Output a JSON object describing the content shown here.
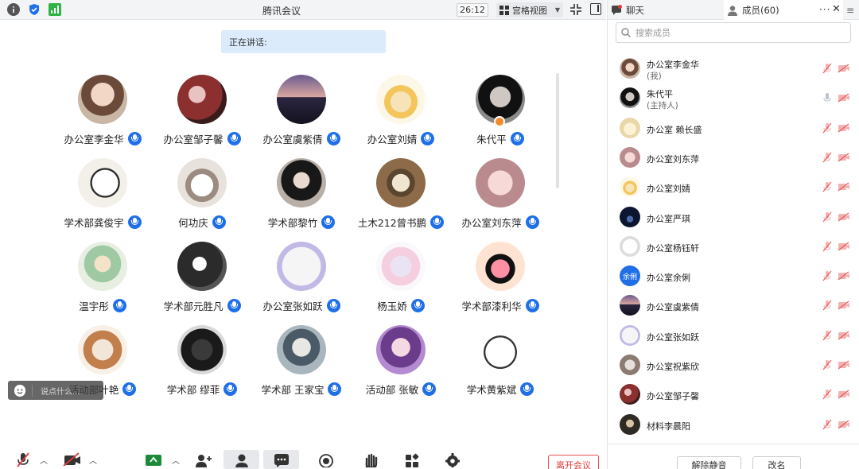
{
  "window": {
    "title": "腾讯会议",
    "timer": "26:12",
    "view_label": "宫格视图"
  },
  "speaking": {
    "label": "正在讲话:"
  },
  "participants": [
    {
      "name": "办公室李金华"
    },
    {
      "name": "办公室邹子馨"
    },
    {
      "name": "办公室虞紫倩"
    },
    {
      "name": "办公室刘婧"
    },
    {
      "name": "朱代平"
    },
    {
      "name": "学术部龚俊宇"
    },
    {
      "name": "何功庆"
    },
    {
      "name": "学术部黎竹"
    },
    {
      "name": "土木212曾书鹏"
    },
    {
      "name": "办公室刘东萍"
    },
    {
      "name": "温宇彤"
    },
    {
      "name": "学术部元胜凡"
    },
    {
      "name": "办公室张如跃"
    },
    {
      "name": "杨玉娇"
    },
    {
      "name": "学术部漆利华"
    },
    {
      "name": "活动部叶艳"
    },
    {
      "name": "学术部 缪菲"
    },
    {
      "name": "学术部 王家宝"
    },
    {
      "name": "活动部 张敏"
    },
    {
      "name": "学术黄紫斌"
    }
  ],
  "chat_input": {
    "placeholder": "说点什么..."
  },
  "toolbar": {
    "leave_label": "离开会议"
  },
  "right_panel": {
    "tab_chat": "聊天",
    "tab_members": "成员(60)",
    "search_placeholder": "搜索成员",
    "members": [
      {
        "name": "办公室李金华",
        "sub": "(我)"
      },
      {
        "name": "朱代平",
        "sub": "(主持人)"
      },
      {
        "name": "办公室 赖长盛",
        "sub": ""
      },
      {
        "name": "办公室刘东萍",
        "sub": ""
      },
      {
        "name": "办公室刘婧",
        "sub": ""
      },
      {
        "name": "办公室严琪",
        "sub": ""
      },
      {
        "name": "办公室杨钰轩",
        "sub": ""
      },
      {
        "name": "办公室余俐",
        "sub": "",
        "avatar_text": "余俐"
      },
      {
        "name": "办公室虞紫倩",
        "sub": ""
      },
      {
        "name": "办公室张如跃",
        "sub": ""
      },
      {
        "name": "办公室祝紫欣",
        "sub": ""
      },
      {
        "name": "办公室邹子馨",
        "sub": ""
      },
      {
        "name": "材料李晨阳",
        "sub": ""
      }
    ],
    "unmute_all_label": "解除静音",
    "rename_label": "改名"
  },
  "colors": {
    "accent": "#1e6fe8",
    "danger": "#e03a3a",
    "speaking_bg": "#dcebfb"
  }
}
